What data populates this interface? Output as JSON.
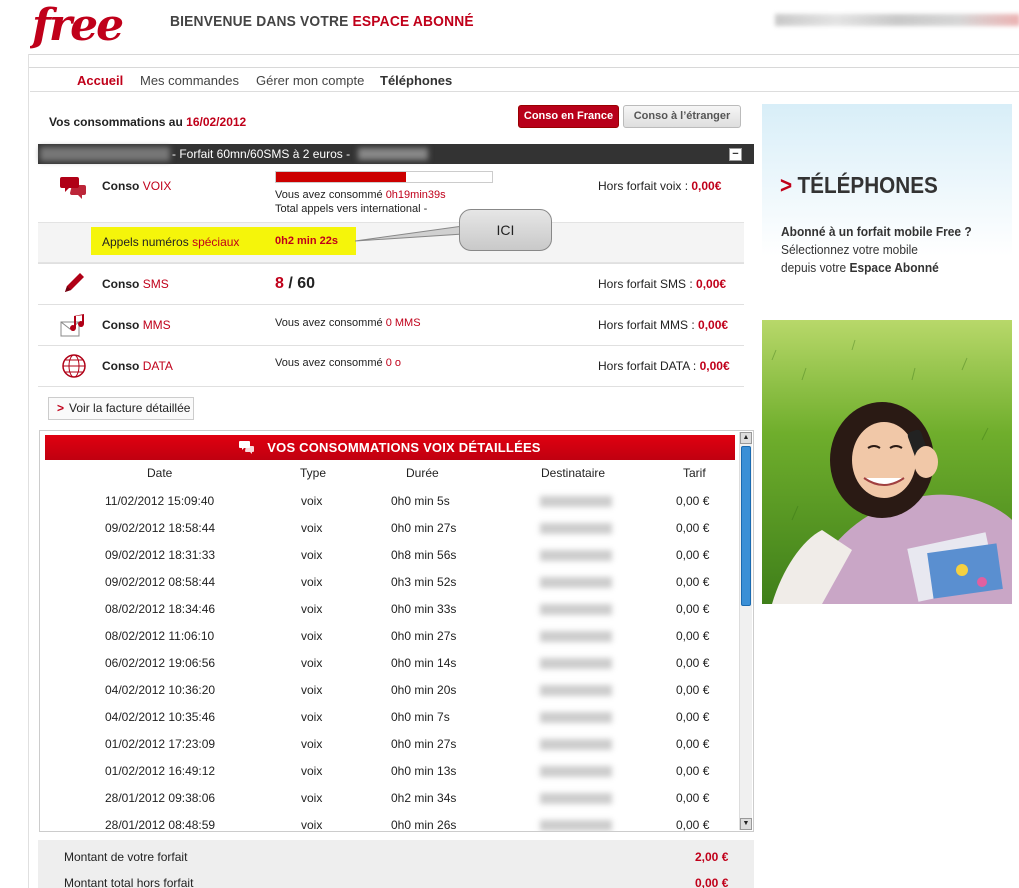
{
  "header": {
    "logo_text": "free",
    "welcome_prefix": "BIENVENUE DANS VOTRE",
    "welcome_suffix": "ESPACE ABONNÉ"
  },
  "nav": {
    "items": [
      {
        "label": "Accueil"
      },
      {
        "label": "Mes commandes"
      },
      {
        "label": "Gérer mon compte"
      },
      {
        "label": "Téléphones"
      }
    ]
  },
  "conso": {
    "title_prefix": "Vos consommations au",
    "date": "16/02/2012",
    "btn_france": "Conso en France",
    "btn_etranger": "Conso à l’étranger",
    "forfait_label": "- Forfait 60mn/60SMS à 2 euros -",
    "collapse_symbol": "−",
    "voix": {
      "label": "Conso",
      "label_red": "VOIX",
      "progress_fraction": 0.6,
      "consumed_prefix": "Vous avez consommé",
      "consumed_value": "0h19min39s",
      "international": "Total appels vers international -",
      "hors_forfait_label": "Hors forfait voix :",
      "hors_forfait_value": "0,00€"
    },
    "special": {
      "label": "Appels numéros",
      "label_red": "spéciaux",
      "value": "0h2 min 22s",
      "bubble": "ICI"
    },
    "sms": {
      "label": "Conso",
      "label_red": "SMS",
      "used": "8",
      "sep": "/",
      "total": "60",
      "hors_forfait_label": "Hors forfait SMS :",
      "hors_forfait_value": "0,00€"
    },
    "mms": {
      "label": "Conso",
      "label_red": "MMS",
      "consumed_prefix": "Vous avez consommé",
      "consumed_value": "0 MMS",
      "hors_forfait_label": "Hors forfait MMS :",
      "hors_forfait_value": "0,00€"
    },
    "data": {
      "label": "Conso",
      "label_red": "DATA",
      "consumed_prefix": "Vous avez consommé",
      "consumed_value": "0 o",
      "hors_forfait_label": "Hors forfait DATA :",
      "hors_forfait_value": "0,00€"
    },
    "voir_facture_arrow": ">",
    "voir_facture": "Voir la facture détaillée"
  },
  "details": {
    "title_bold_prefix": "VOS CONSOMMATIONS",
    "title_light": "VOIX",
    "title_bold_suffix": "DÉTAILLÉES",
    "columns": [
      "Date",
      "Type",
      "Durée",
      "Destinataire",
      "Tarif"
    ],
    "rows": [
      {
        "date": "11/02/2012 15:09:40",
        "type": "voix",
        "duree": "0h0 min 5s",
        "tarif": "0,00 €"
      },
      {
        "date": "09/02/2012 18:58:44",
        "type": "voix",
        "duree": "0h0 min 27s",
        "tarif": "0,00 €"
      },
      {
        "date": "09/02/2012 18:31:33",
        "type": "voix",
        "duree": "0h8 min 56s",
        "tarif": "0,00 €"
      },
      {
        "date": "09/02/2012 08:58:44",
        "type": "voix",
        "duree": "0h3 min 52s",
        "tarif": "0,00 €"
      },
      {
        "date": "08/02/2012 18:34:46",
        "type": "voix",
        "duree": "0h0 min 33s",
        "tarif": "0,00 €"
      },
      {
        "date": "08/02/2012 11:06:10",
        "type": "voix",
        "duree": "0h0 min 27s",
        "tarif": "0,00 €"
      },
      {
        "date": "06/02/2012 19:06:56",
        "type": "voix",
        "duree": "0h0 min 14s",
        "tarif": "0,00 €"
      },
      {
        "date": "04/02/2012 10:36:20",
        "type": "voix",
        "duree": "0h0 min 20s",
        "tarif": "0,00 €"
      },
      {
        "date": "04/02/2012 10:35:46",
        "type": "voix",
        "duree": "0h0 min 7s",
        "tarif": "0,00 €"
      },
      {
        "date": "01/02/2012 17:23:09",
        "type": "voix",
        "duree": "0h0 min 27s",
        "tarif": "0,00 €"
      },
      {
        "date": "01/02/2012 16:49:12",
        "type": "voix",
        "duree": "0h0 min 13s",
        "tarif": "0,00 €"
      },
      {
        "date": "28/01/2012 09:38:06",
        "type": "voix",
        "duree": "0h2 min 34s",
        "tarif": "0,00 €"
      },
      {
        "date": "28/01/2012 08:48:59",
        "type": "voix",
        "duree": "0h0 min 26s",
        "tarif": "0,00 €"
      }
    ]
  },
  "totals": {
    "forfait_label": "Montant de votre forfait",
    "forfait_value": "2,00 €",
    "hors_forfait_label": "Montant total hors forfait",
    "hors_forfait_value": "0,00 €"
  },
  "promo": {
    "arrow": ">",
    "title": "TÉLÉPHONES",
    "line1": "Abonné à un forfait mobile Free ?",
    "line2": "Sélectionnez votre mobile",
    "line3_prefix": "depuis votre",
    "line3_bold": "Espace Abonné"
  },
  "colors": {
    "brand_red": "#c0001a",
    "highlight_yellow": "#f5f50a"
  },
  "icons": [
    "speech-bubbles-icon",
    "pencil-icon",
    "music-envelope-icon",
    "globe-icon"
  ]
}
